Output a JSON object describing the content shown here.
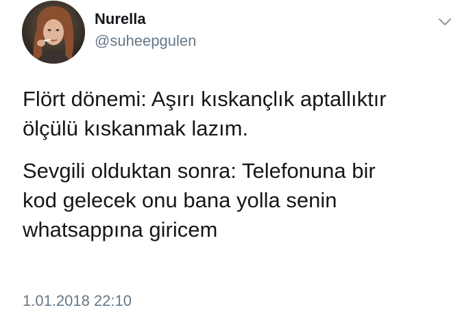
{
  "user": {
    "display_name": "Nurella",
    "handle": "@suheepgulen"
  },
  "tweet": {
    "paragraphs": [
      "Flört dönemi: Aşırı kıskançlık aptallıktır\nölçülü kıskanmak lazım.",
      "Sevgili olduktan sonra: Telefonuna bir\nkod gelecek onu bana yolla senin\nwhatsappına giricem"
    ],
    "timestamp": "1.01.2018 22:10"
  },
  "icons": {
    "avatar": "profile-photo",
    "menu": "chevron-down-icon"
  },
  "colors": {
    "text": "#14171a",
    "secondary": "#657786",
    "background": "#ffffff"
  }
}
